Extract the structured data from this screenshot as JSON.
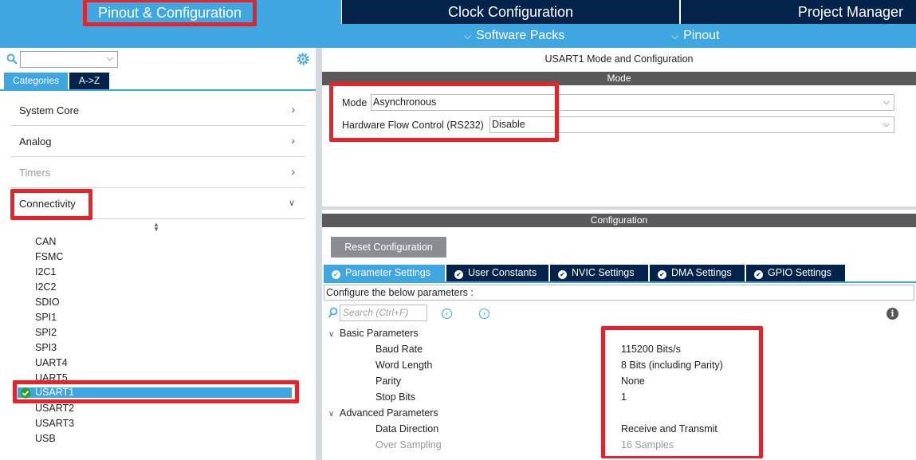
{
  "top_tabs": {
    "pinout": "Pinout & Configuration",
    "clock": "Clock Configuration",
    "project": "Project Manager"
  },
  "sub_menu": {
    "software_packs": "Software Packs",
    "pinout": "Pinout"
  },
  "left_panel": {
    "search_value": "",
    "tabs": {
      "categories": "Categories",
      "az": "A->Z"
    },
    "categories": [
      {
        "label": "System Core"
      },
      {
        "label": "Analog"
      },
      {
        "label": "Timers"
      },
      {
        "label": "Connectivity"
      }
    ],
    "peripherals": [
      "CAN",
      "FSMC",
      "I2C1",
      "I2C2",
      "SDIO",
      "SPI1",
      "SPI2",
      "SPI3",
      "UART4",
      "UART5",
      "USART1",
      "USART2",
      "USART3",
      "USB"
    ],
    "selected_peripheral": "USART1"
  },
  "right_panel": {
    "title": "USART1 Mode and Configuration",
    "mode_section": "Mode",
    "mode_label": "Mode",
    "mode_value": "Asynchronous",
    "flow_label": "Hardware Flow Control (RS232)",
    "flow_value": "Disable",
    "config_section": "Configuration",
    "reset_button": "Reset Configuration",
    "config_tabs": [
      "Parameter Settings",
      "User Constants",
      "NVIC Settings",
      "DMA Settings",
      "GPIO Settings"
    ],
    "hint": "Configure the below parameters :",
    "search_placeholder": "Search (Ctrl+F)",
    "groups": {
      "basic": "Basic Parameters",
      "advanced": "Advanced Parameters"
    },
    "basic_params": [
      {
        "name": "Baud Rate",
        "value": "115200 Bits/s"
      },
      {
        "name": "Word Length",
        "value": "8 Bits (including Parity)"
      },
      {
        "name": "Parity",
        "value": "None"
      },
      {
        "name": "Stop Bits",
        "value": "1"
      }
    ],
    "advanced_params": [
      {
        "name": "Data Direction",
        "value": "Receive and Transmit"
      },
      {
        "name": "Over Sampling",
        "value": "16 Samples"
      }
    ]
  },
  "colors": {
    "accent_blue": "#3ea6e0",
    "navy": "#03234b",
    "highlight_red": "#e6232a",
    "section_grey": "#5a5a5a"
  }
}
